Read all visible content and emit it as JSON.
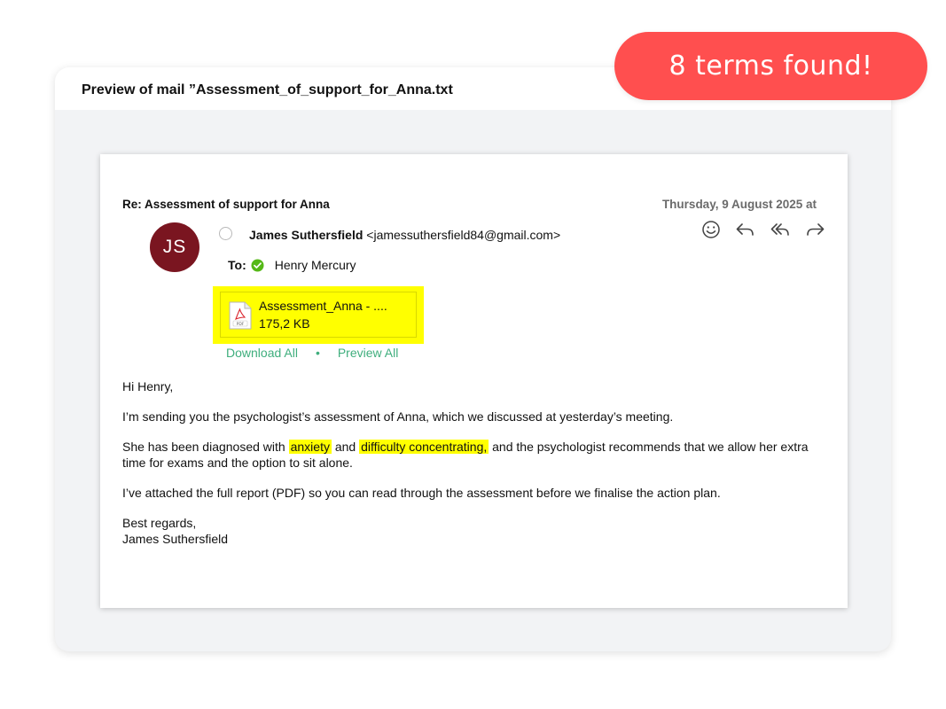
{
  "preview": {
    "title": "Preview of mail ”Assessment_of_support_for_Anna.txt"
  },
  "badge": {
    "text": "8 terms found!"
  },
  "email": {
    "subject": "Re: Assessment of support for Anna",
    "date": "Thursday, 9 August 2025 at",
    "avatar_initials": "JS",
    "sender_name": "James Suthersfield",
    "sender_email": "<jamessuthersfield84@gmail.com>",
    "to_label": "To:",
    "recipient": "Henry Mercury",
    "attachment": {
      "name": "Assessment_Anna - ....",
      "size": "175,2 KB",
      "icon": "pdf-file-icon"
    },
    "links": {
      "download_all": "Download All",
      "separator": "•",
      "preview_all": "Preview All"
    },
    "actions": [
      "emoji-icon",
      "reply-icon",
      "reply-all-icon",
      "forward-icon"
    ],
    "body": {
      "greeting": "Hi Henry,",
      "p1": "I’m sending you the psychologist’s assessment of Anna, which we discussed at yesterday’s meeting.",
      "p2_a": "She has been diagnosed with ",
      "p2_hl1": "anxiety",
      "p2_b": " and ",
      "p2_hl2": "difficulty concentrating,",
      "p2_c": " and the psychologist recommends that we allow her extra time for exams and the option to sit alone.",
      "p3": "I’ve attached the full report (PDF) so you can read through the assessment before we finalise the action plan.",
      "signoff": "Best regards,",
      "signature": "James Suthersfield"
    }
  },
  "colors": {
    "badge": "#ff4f4f",
    "avatar": "#7a1520",
    "highlight": "#ffff00",
    "link": "#3fae7d",
    "check": "#55b817"
  }
}
